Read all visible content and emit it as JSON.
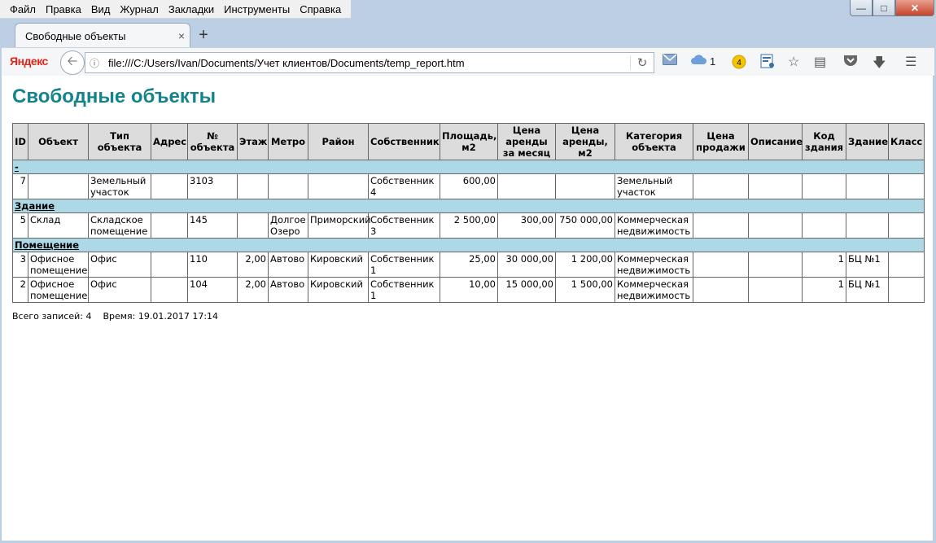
{
  "menu": [
    "Файл",
    "Правка",
    "Вид",
    "Журнал",
    "Закладки",
    "Инструменты",
    "Справка"
  ],
  "tab": {
    "title": "Свободные объекты",
    "close": "×",
    "new_tab": "+"
  },
  "nav": {
    "brand": "Яндекс",
    "url": "file:///C:/Users/Ivan/Documents/Учет клиентов/Documents/temp_report.htm",
    "cloud_count": "1",
    "badge_count": "4"
  },
  "page": {
    "title": "Свободные объекты",
    "columns": [
      "ID",
      "Объект",
      "Тип объекта",
      "Адрес",
      "№ объекта",
      "Этаж",
      "Метро",
      "Район",
      "Собственник",
      "Площадь, м2",
      "Цена аренды за месяц",
      "Цена аренды, м2",
      "Категория объекта",
      "Цена продажи",
      "Описание",
      "Код здания",
      "Здание",
      "Класс"
    ],
    "groups": [
      {
        "name": "-",
        "rows": [
          [
            "7",
            "",
            "Земельный участок",
            "",
            "3103",
            "",
            "",
            "",
            "Собственник 4",
            "600,00",
            "",
            "",
            "Земельный участок",
            "",
            "",
            "",
            "",
            ""
          ]
        ]
      },
      {
        "name": "Здание",
        "rows": [
          [
            "5",
            "Склад",
            "Складское помещение",
            "",
            "145",
            "",
            "Долгое Озеро",
            "Приморский",
            "Собственник 3",
            "2 500,00",
            "300,00",
            "750 000,00",
            "Коммерческая недвижимость",
            "",
            "",
            "",
            "",
            ""
          ]
        ]
      },
      {
        "name": "Помещение",
        "rows": [
          [
            "3",
            "Офисное помещение",
            "Офис",
            "",
            "110",
            "2,00",
            "Автово",
            "Кировский",
            "Собственник 1",
            "25,00",
            "30 000,00",
            "1 200,00",
            "Коммерческая недвижимость",
            "",
            "",
            "1",
            "БЦ №1",
            ""
          ],
          [
            "2",
            "Офисное помещение",
            "Офис",
            "",
            "104",
            "2,00",
            "Автово",
            "Кировский",
            "Собственник 1",
            "10,00",
            "15 000,00",
            "1 500,00",
            "Коммерческая недвижимость",
            "",
            "",
            "1",
            "БЦ №1",
            ""
          ]
        ]
      }
    ],
    "footer": "Всего записей: 4    Время: 19.01.2017 17:14"
  }
}
